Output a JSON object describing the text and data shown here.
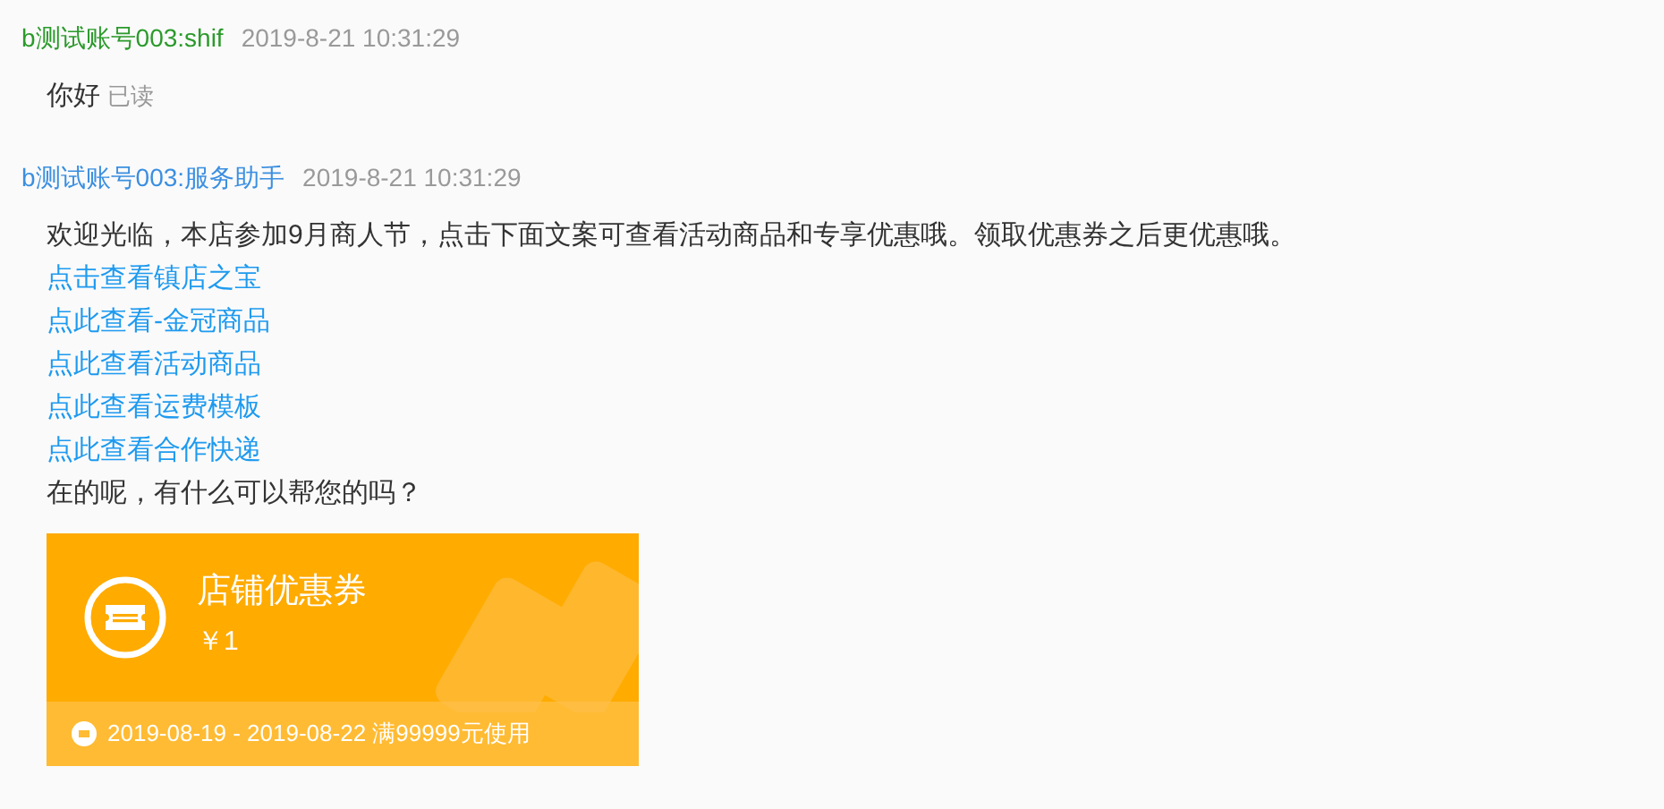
{
  "messages": [
    {
      "sender": "b测试账号003:shif",
      "kind": "buyer",
      "time": "2019-8-21 10:31:29",
      "lines": [
        {
          "kind": "text",
          "text": "你好"
        }
      ],
      "status": "已读"
    },
    {
      "sender": "b测试账号003:服务助手",
      "kind": "agent",
      "time": "2019-8-21 10:31:29",
      "lines": [
        {
          "kind": "text",
          "text": "欢迎光临，本店参加9月商人节，点击下面文案可查看活动商品和专享优惠哦。领取优惠券之后更优惠哦。"
        },
        {
          "kind": "link",
          "text": "点击查看镇店之宝"
        },
        {
          "kind": "link",
          "text": "点此查看-金冠商品"
        },
        {
          "kind": "link",
          "text": "点此查看活动商品"
        },
        {
          "kind": "link",
          "text": "点此查看运费模板"
        },
        {
          "kind": "link",
          "text": "点此查看合作快递"
        },
        {
          "kind": "text",
          "text": "在的呢，有什么可以帮您的吗？"
        }
      ],
      "coupon": {
        "title": "店铺优惠券",
        "amount": "￥1",
        "validity": "2019-08-19 - 2019-08-22 满99999元使用"
      }
    }
  ]
}
